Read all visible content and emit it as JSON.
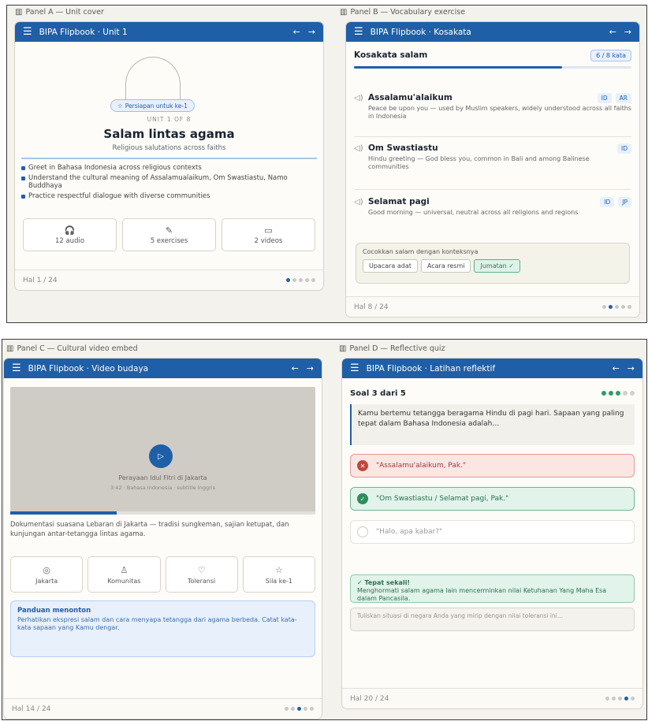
{
  "panel_a": {
    "label": "Panel A — Unit cover",
    "topbar_title": "BIPA Flipbook · Unit 1",
    "badge": "Persiapan untuk ke-1",
    "unit_of": "UNIT 1 OF 8",
    "title": "Salam lintas agama",
    "subtitle": "Religious salutations across faiths",
    "bullets": [
      "Greet in Bahasa Indonesia across religious contexts",
      "Understand the cultural meaning of Assalamualaikum, Om Swastiastu, Namo Buddhaya",
      "Practice respectful dialogue with diverse communities"
    ],
    "stats": [
      {
        "icon": "headphones-icon",
        "glyph": "🎧",
        "label": "12 audio"
      },
      {
        "icon": "puzzle-icon",
        "glyph": "✎",
        "label": "5 exercises"
      },
      {
        "icon": "video-icon",
        "glyph": "▭",
        "label": "2 videos"
      }
    ],
    "page": "Hal 1 / 24",
    "dots_active": 0
  },
  "panel_b": {
    "label": "Panel B — Vocabulary exercise",
    "topbar_title": "BIPA Flipbook · Kosakata",
    "heading": "Kosakata salam",
    "count": "6 / 8 kata",
    "progress": 0.75,
    "items": [
      {
        "word": "Assalamu'alaikum",
        "tags": [
          "ID",
          "AR"
        ],
        "def": "Peace be upon you — used by Muslim speakers, widely understood across all faiths in Indonesia"
      },
      {
        "word": "Om Swastiastu",
        "tags": [
          "ID"
        ],
        "def": "Hindu greeting — God bless you, common in Bali and among Balinese communities"
      },
      {
        "word": "Selamat pagi",
        "tags": [
          "ID",
          "JP"
        ],
        "def": "Good morning — universal, neutral across all religions and regions"
      }
    ],
    "match_title": "Cocokkan salam dengan konteksnya",
    "chips": [
      {
        "label": "Upacara adat",
        "ok": false
      },
      {
        "label": "Acara resmi",
        "ok": false
      },
      {
        "label": "Jumatan ✓",
        "ok": true
      }
    ],
    "page": "Hal 8 / 24",
    "dots_active": 1
  },
  "panel_c": {
    "label": "Panel C — Cultural video embed",
    "topbar_title": "BIPA Flipbook · Video budaya",
    "video_caption": "Perayaan Idul Fitri di Jakarta",
    "video_meta": "3:42 · Bahasa Indonesia · subtitle Inggris",
    "video_progress": 0.35,
    "description": "Dokumentasi suasana Lebaran di Jakarta — tradisi sungkeman, sajian ketupat, dan kunjungan antar-tetangga lintas agama.",
    "tags": [
      {
        "icon": "location-icon",
        "glyph": "◎",
        "label": "Jakarta"
      },
      {
        "icon": "community-icon",
        "glyph": "♙",
        "label": "Komunitas"
      },
      {
        "icon": "heart-icon",
        "glyph": "♡",
        "label": "Toleransi"
      },
      {
        "icon": "star-icon",
        "glyph": "☆",
        "label": "Sila ke-1"
      }
    ],
    "guide_title": "Panduan menonton",
    "guide_body": "Perhatikan ekspresi salam dan cara menyapa tetangga dari agama berbeda. Catat kata-kata sapaan yang Kamu dengar.",
    "page": "Hal 14 / 24",
    "dots_active": 2
  },
  "panel_d": {
    "label": "Panel D — Reflective quiz",
    "topbar_title": "BIPA Flipbook · Latihan reflektif",
    "heading": "Soal 3 dari 5",
    "quiz_done": 3,
    "quiz_total": 5,
    "prompt": "Kamu bertemu tetangga beragama Hindu di pagi hari. Sapaan yang paling tepat dalam Bahasa Indonesia adalah…",
    "options": [
      {
        "text": "\"Assalamu'alaikum, Pak.\"",
        "state": "wrong",
        "mark": "✕"
      },
      {
        "text": "\"Om Swastiastu / Selamat pagi, Pak.\"",
        "state": "right",
        "mark": "✓"
      },
      {
        "text": "\"Halo, apa kabar?\"",
        "state": "neutral",
        "mark": ""
      }
    ],
    "feedback_title": "✓ Tepat sekali!",
    "feedback_body": "Menghormati salam agama lain mencerminkan nilai Ketuhanan Yang Maha Esa dalam Pancasila.",
    "reflect_placeholder": "Tuliskan situasi di negara Anda yang mirip dengan nilai toleransi ini…",
    "page": "Hal 20 / 24",
    "dots_active": 3
  },
  "colors": {
    "accent": "#1f5fa8",
    "success": "#2f8c5c",
    "error": "#c0473c"
  }
}
